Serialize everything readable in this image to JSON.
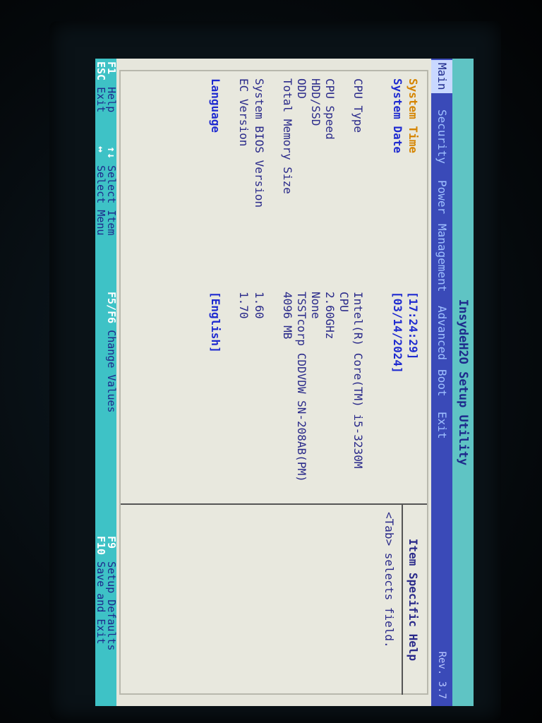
{
  "title": "InsydeH2O Setup Utility",
  "menu": {
    "items": [
      "Main",
      "Security",
      "Power",
      "Management",
      "Advanced",
      "Boot",
      "Exit"
    ],
    "selected": "Main",
    "vendor": "Rev. 3.7"
  },
  "fields": {
    "system_time": {
      "label": "System Time",
      "value": "[17:24:29]"
    },
    "system_date": {
      "label": "System Date",
      "value": "[03/14/2024]"
    },
    "cpu_type": {
      "label": "CPU Type",
      "value_line1": "Intel(R) Core(TM) i5-3230M",
      "value_line2": "CPU"
    },
    "cpu_speed": {
      "label": "CPU Speed",
      "value": "2.60GHz"
    },
    "hdd_ssd": {
      "label": "HDD/SSD",
      "value": "None"
    },
    "odd": {
      "label": "ODD",
      "value": "TSSTcorp CDDVDW SN-208AB(PM)"
    },
    "total_memory": {
      "label": "Total Memory Size",
      "value": "4096 MB"
    },
    "bios_version": {
      "label": "System BIOS Version",
      "value": "1.60"
    },
    "ec_version": {
      "label": "EC Version",
      "value": "1.70"
    },
    "language": {
      "label": "Language",
      "value": "[English]"
    }
  },
  "help": {
    "heading": "Item Specific Help",
    "text": "<Tab> selects field."
  },
  "footer": {
    "f1": {
      "key": "F1",
      "desc": "Help"
    },
    "esc": {
      "key": "ESC",
      "desc": "Exit"
    },
    "ud": {
      "key": "↑↓",
      "desc": "Select Item"
    },
    "lr": {
      "key": "↔",
      "desc": "Select Menu"
    },
    "f5f6": {
      "key": "F5/F6",
      "desc": "Change Values"
    },
    "f9": {
      "key": "F9",
      "desc": "Setup Defaults"
    },
    "f10": {
      "key": "F10",
      "desc": "Save and Exit"
    }
  },
  "colors": {
    "title_bar": "#5fc4c4",
    "menu_bar": "#3a4ab8",
    "panel": "#e8e8de",
    "footer": "#3ec2c6",
    "text_blue": "#2a2a8a"
  }
}
